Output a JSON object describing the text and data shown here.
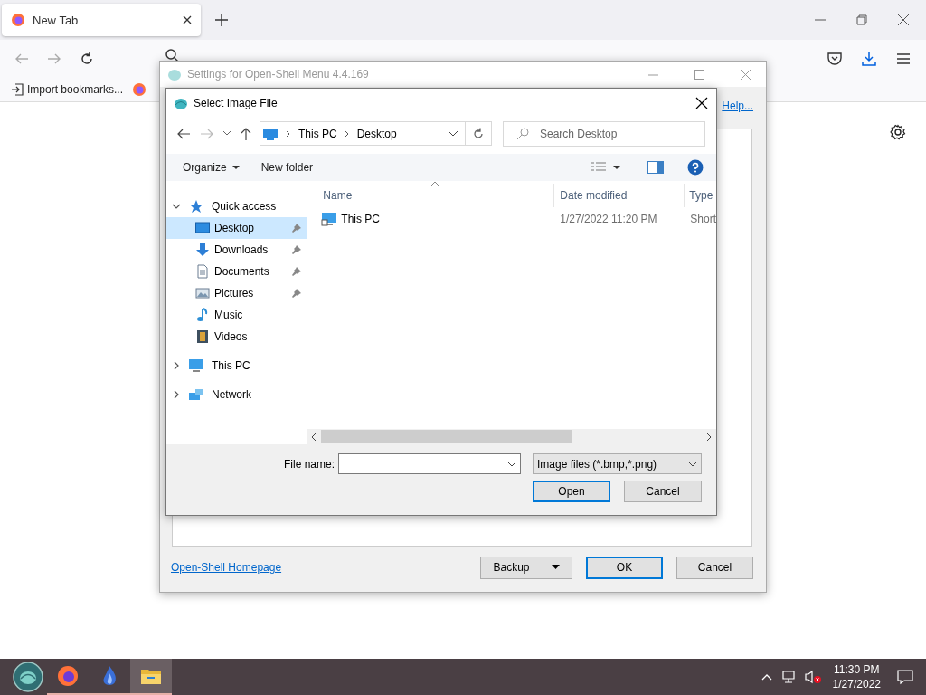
{
  "browser": {
    "tabs": [
      {
        "label": "New Tab",
        "selected": true
      }
    ],
    "bookmarks": [
      {
        "label": "Import bookmarks...",
        "kind": "import"
      },
      {
        "kind": "firefox"
      }
    ]
  },
  "settings_window": {
    "title": "Settings for Open-Shell Menu 4.4.169",
    "help_link": "Help...",
    "homepage_link": "Open-Shell Homepage",
    "buttons": [
      {
        "label": "Backup",
        "kind": "dropdown",
        "default": false
      },
      {
        "label": "OK",
        "kind": "plain",
        "default": true
      },
      {
        "label": "Cancel",
        "kind": "plain",
        "default": false
      }
    ]
  },
  "dialog": {
    "title": "Select Image File",
    "breadcrumb": [
      "This PC",
      "Desktop"
    ],
    "search_placeholder": "Search Desktop",
    "toolbar": [
      {
        "label": "Organize",
        "kind": "menu"
      },
      {
        "label": "New folder",
        "kind": "plain"
      }
    ],
    "nav": [
      {
        "label": "Quick access",
        "kind": "star",
        "expanded": true,
        "selected": false,
        "children": [
          {
            "label": "Desktop",
            "kind": "desktop",
            "pinned": true,
            "selected": true
          },
          {
            "label": "Downloads",
            "kind": "download",
            "pinned": true,
            "selected": false
          },
          {
            "label": "Documents",
            "kind": "document",
            "pinned": true,
            "selected": false
          },
          {
            "label": "Pictures",
            "kind": "pictures",
            "pinned": true,
            "selected": false
          },
          {
            "label": "Music",
            "kind": "music",
            "pinned": false,
            "selected": false
          },
          {
            "label": "Videos",
            "kind": "videos",
            "pinned": false,
            "selected": false
          }
        ]
      },
      {
        "label": "This PC",
        "kind": "pc",
        "expanded": false,
        "selected": false
      },
      {
        "label": "Network",
        "kind": "network",
        "expanded": false,
        "selected": false
      }
    ],
    "columns": [
      "Name",
      "Date modified",
      "Type"
    ],
    "files": [
      {
        "name": "This PC",
        "date": "1/27/2022 11:20 PM",
        "type": "Short"
      }
    ],
    "file_name_label": "File name:",
    "filter": "Image files (*.bmp,*.png)",
    "buttons": [
      {
        "label": "Open",
        "default": true
      },
      {
        "label": "Cancel",
        "default": false
      }
    ]
  },
  "taskbar": {
    "apps": [
      {
        "kind": "firefox",
        "active": false
      },
      {
        "kind": "flame",
        "active": false
      },
      {
        "kind": "folder",
        "active": true
      }
    ],
    "time": "11:30 PM",
    "date": "1/27/2022"
  }
}
